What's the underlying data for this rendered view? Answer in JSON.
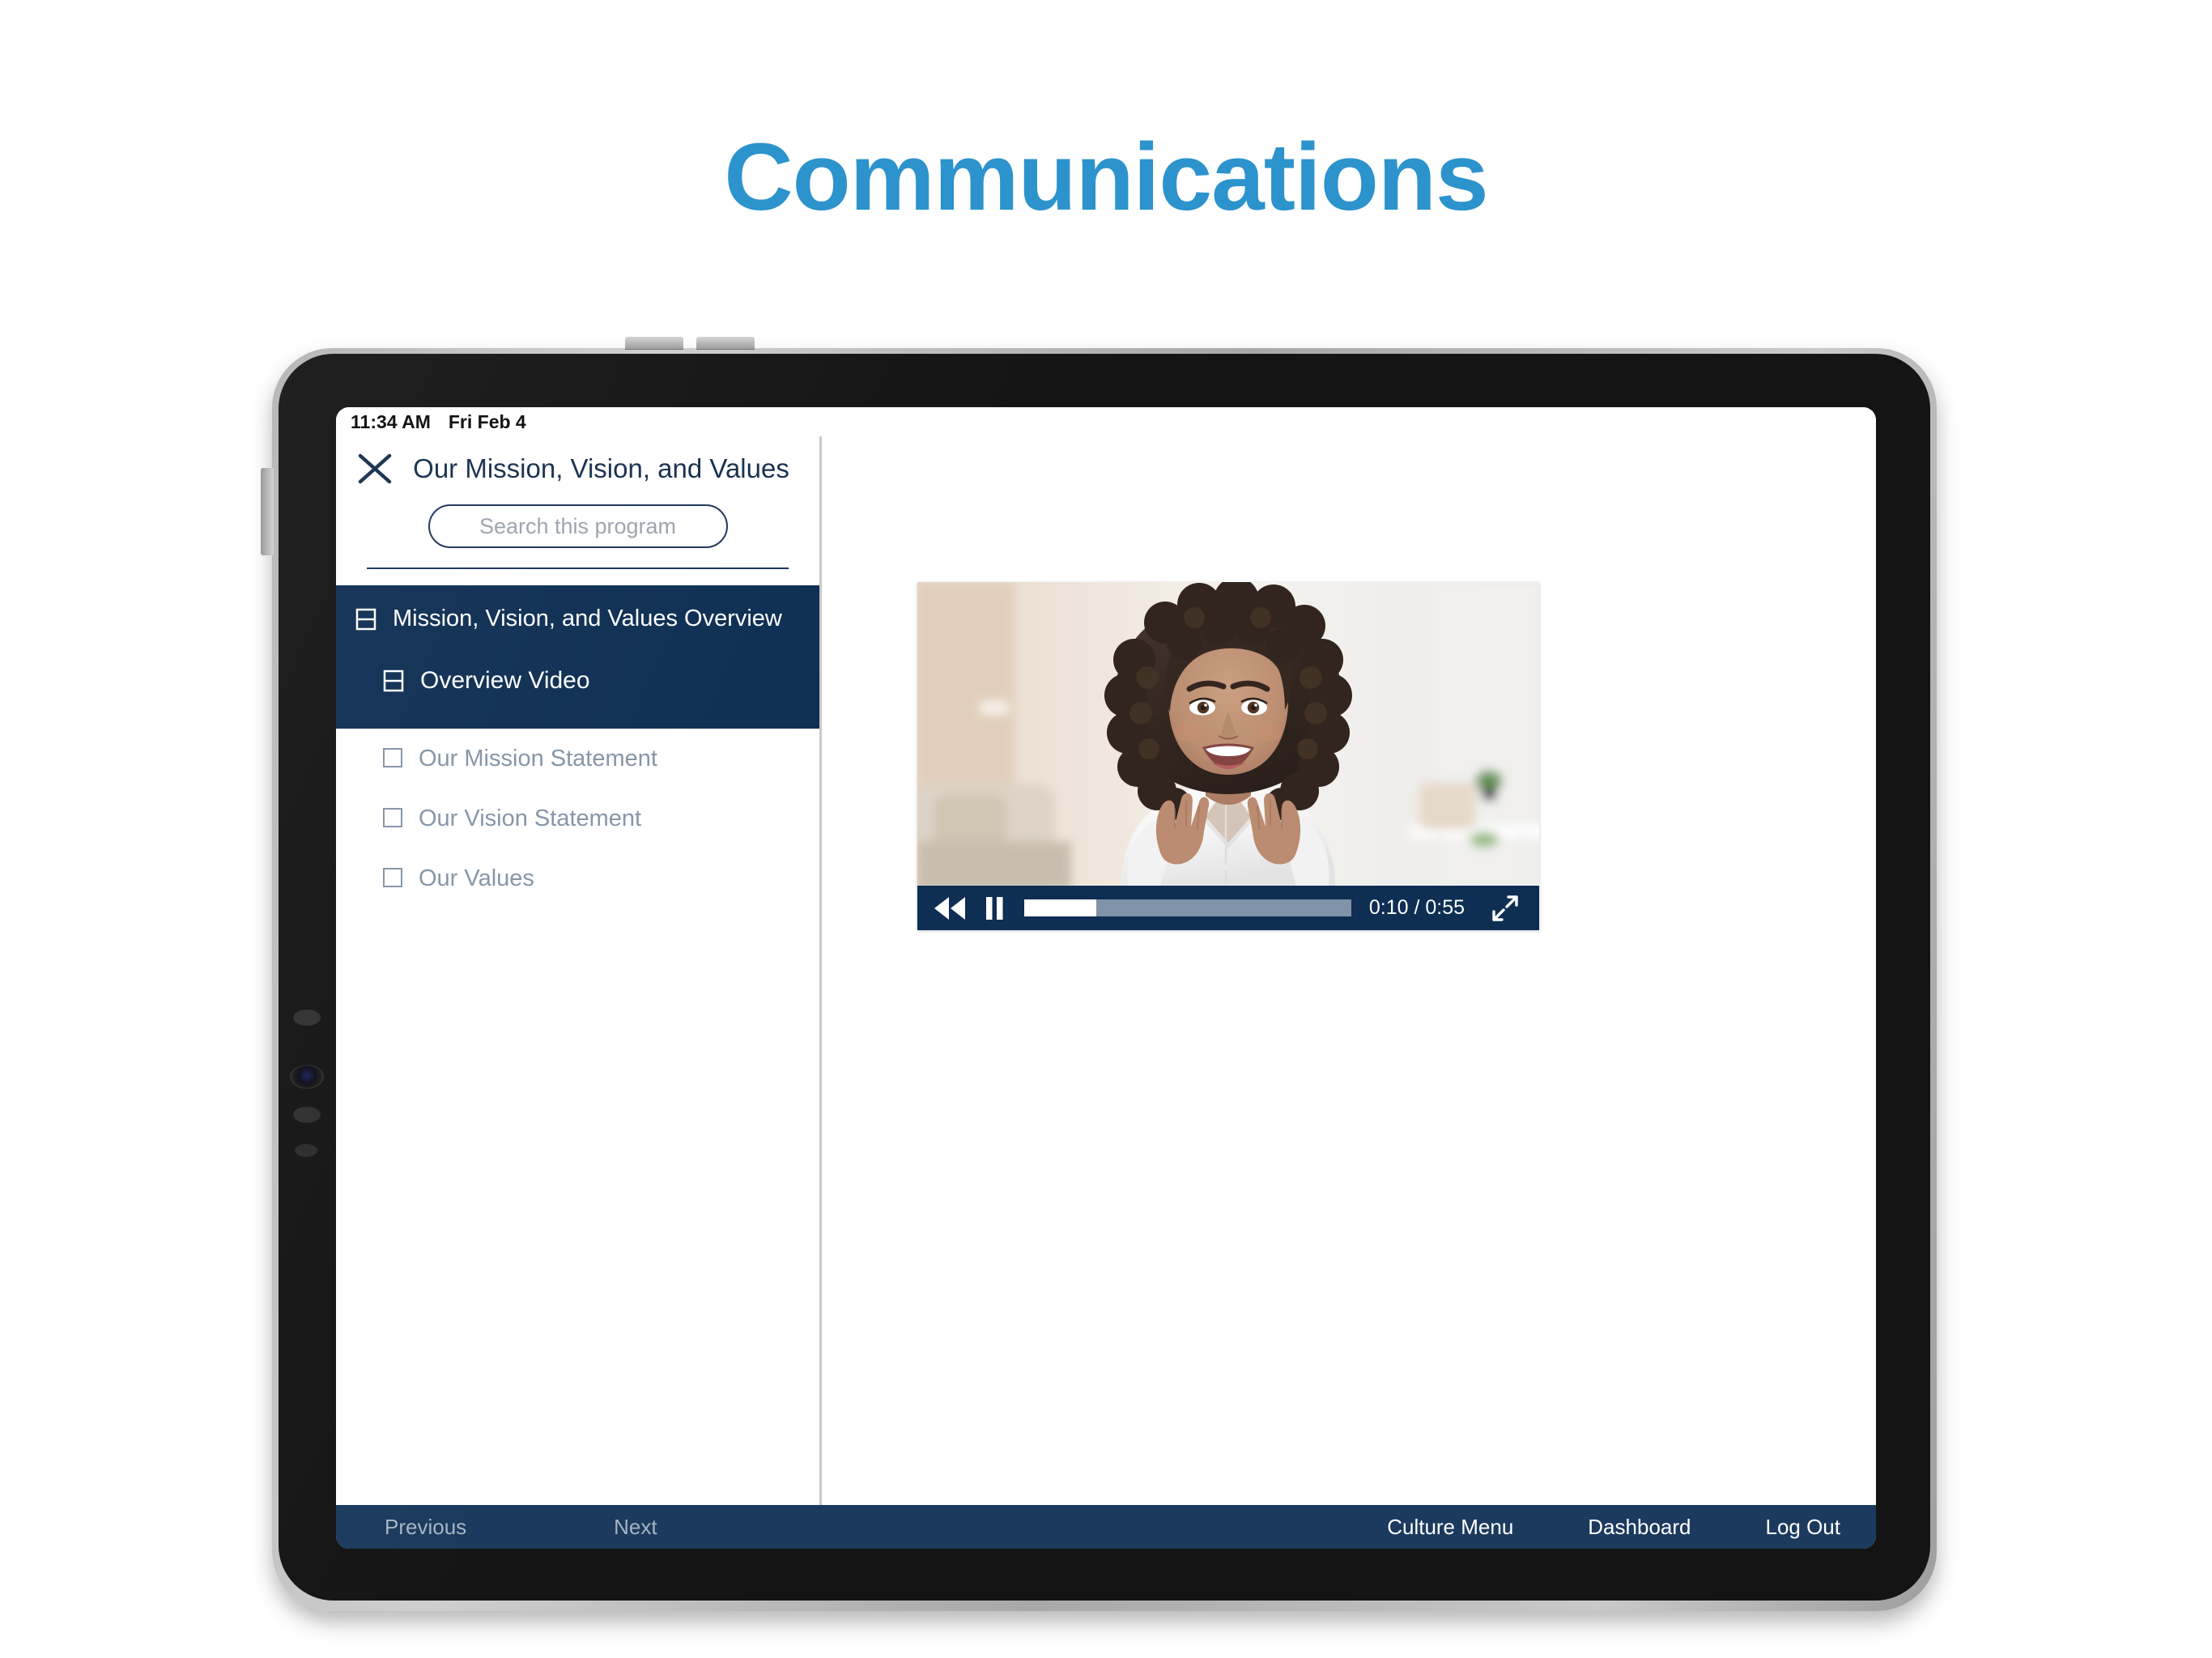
{
  "page": {
    "heading": "Communications"
  },
  "device": {
    "status_bar": {
      "time": "11:34 AM",
      "date": "Fri Feb 4"
    }
  },
  "sidebar": {
    "close_icon": "close-icon",
    "title": "Our Mission, Vision, and Values",
    "search": {
      "placeholder": "Search this program",
      "value": ""
    },
    "items": [
      {
        "label": "Mission, Vision, and Values Overview",
        "icon": "book-icon",
        "state": "group-selected"
      },
      {
        "label": "Overview Video",
        "icon": "book-icon",
        "state": "child-selected"
      },
      {
        "label": "Our Mission Statement",
        "icon": "square-icon",
        "state": "child"
      },
      {
        "label": "Our Vision Statement",
        "icon": "square-icon",
        "state": "child"
      },
      {
        "label": "Our Values",
        "icon": "square-icon",
        "state": "child"
      }
    ]
  },
  "video_player": {
    "rewind_icon": "rewind-icon",
    "pause_icon": "pause-icon",
    "expand_icon": "expand-fullscreen-icon",
    "time_display": "0:10 / 0:55",
    "current_time": "0:10",
    "duration": "0:55",
    "progress_percent": 22
  },
  "bottom_bar": {
    "previous": "Previous",
    "next": "Next",
    "culture_menu": "Culture Menu",
    "dashboard": "Dashboard",
    "log_out": "Log Out"
  },
  "colors": {
    "heading_blue": "#2c93cd",
    "navy": "#0e2e53",
    "bottom_bar_navy": "#1b3a5e",
    "muted_text": "#8494a6",
    "progress_track": "#8193a8"
  }
}
